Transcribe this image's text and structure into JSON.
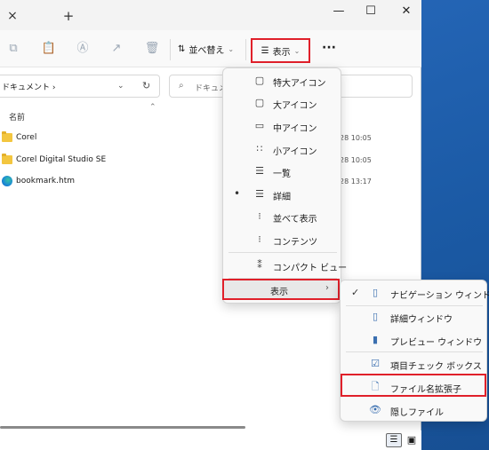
{
  "window": {
    "tab_close": "×",
    "tab_add": "+",
    "controls": {
      "minimize": "—",
      "maximize": "☐",
      "close": "✕"
    }
  },
  "toolbar": {
    "sort_label": "並べ替え",
    "view_label": "表示",
    "more_label": "···"
  },
  "address": {
    "path": "ドキュメント ›",
    "search_placeholder": "ドキュメ"
  },
  "file_list": {
    "column_name": "名前",
    "rows": [
      {
        "name": "Corel",
        "date": "28 10:05",
        "type": "folder"
      },
      {
        "name": "Corel Digital Studio SE",
        "date": "28 10:05",
        "type": "folder"
      },
      {
        "name": "bookmark.htm",
        "date": "28 13:17",
        "type": "edge"
      }
    ]
  },
  "view_menu": {
    "items": [
      {
        "label": "特大アイコン",
        "icon": "extra-large-icon",
        "glyph": "▢"
      },
      {
        "label": "大アイコン",
        "icon": "large-icon",
        "glyph": "▢"
      },
      {
        "label": "中アイコン",
        "icon": "medium-icon",
        "glyph": "▭"
      },
      {
        "label": "小アイコン",
        "icon": "small-icons-icon",
        "glyph": "∷"
      },
      {
        "label": "一覧",
        "icon": "list-icon",
        "glyph": "☰"
      },
      {
        "label": "詳細",
        "icon": "details-icon",
        "glyph": "☰",
        "selected": true
      },
      {
        "label": "並べて表示",
        "icon": "tiles-icon",
        "glyph": "⁝"
      },
      {
        "label": "コンテンツ",
        "icon": "content-icon",
        "glyph": "⁝"
      },
      {
        "label": "コンパクト ビュー",
        "icon": "compact-view-icon",
        "glyph": "⁑"
      }
    ],
    "show_label": "表示",
    "show_arrow": "›"
  },
  "show_submenu": {
    "items": [
      {
        "label": "ナビゲーション ウィンドウ",
        "checked": true,
        "icon": "navigation-pane-icon"
      },
      {
        "label": "詳細ウィンドウ",
        "checked": false,
        "icon": "details-pane-icon"
      },
      {
        "label": "プレビュー ウィンドウ",
        "checked": false,
        "icon": "preview-pane-icon"
      },
      {
        "label": "項目チェック ボックス",
        "checked": false,
        "icon": "item-checkbox-icon"
      },
      {
        "label": "ファイル名拡張子",
        "checked": false,
        "icon": "file-extension-icon"
      },
      {
        "label": "隠しファイル",
        "checked": false,
        "icon": "hidden-files-icon"
      }
    ]
  },
  "colors": {
    "highlight": "#e0202a",
    "accent": "#3a6fb0"
  }
}
